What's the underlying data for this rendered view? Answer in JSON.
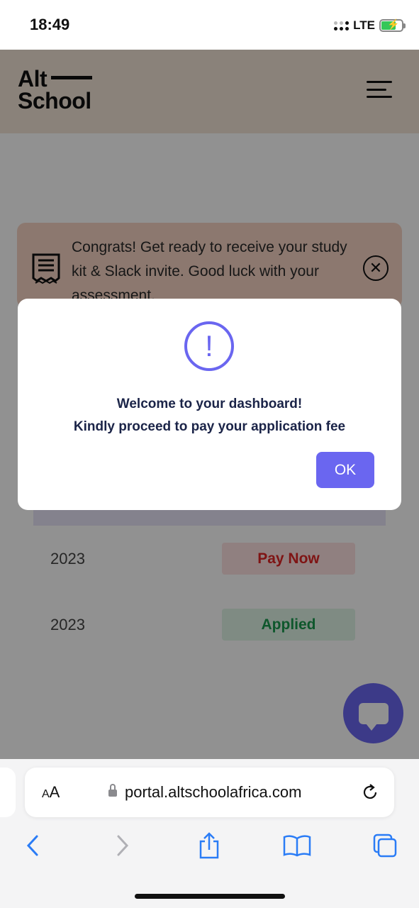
{
  "status_bar": {
    "time": "18:49",
    "network": "LTE"
  },
  "site": {
    "logo_line1": "Alt",
    "logo_line2": "School",
    "banner_text": "Congrats! Get ready to receive your study kit & Slack invite. Good luck with your assessment."
  },
  "rows": [
    {
      "year": "2023",
      "status": "Pay Now"
    },
    {
      "year": "2023",
      "status": "Applied"
    }
  ],
  "modal": {
    "line1": "Welcome to your dashboard!",
    "line2": "Kindly proceed to pay your application fee",
    "ok_label": "OK"
  },
  "browser": {
    "text_size_label_small": "A",
    "text_size_label_large": "A",
    "url": "portal.altschoolafrica.com"
  },
  "colors": {
    "accent": "#6a66f0",
    "header_bg": "#f3e5d6",
    "pay_now": "#e02424",
    "applied": "#1a9a4e",
    "modal_text": "#1b2448"
  }
}
